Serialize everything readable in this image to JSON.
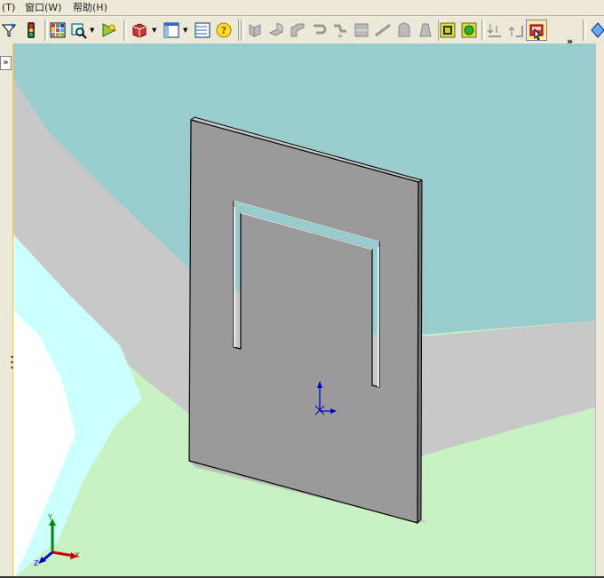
{
  "menu": {
    "items": [
      {
        "label": "(T)"
      },
      {
        "label": "窗口(W)"
      },
      {
        "label": "帮助(H)"
      }
    ]
  },
  "toolbar": {
    "overflow": "»",
    "active_tool": "section-view"
  },
  "panel": {
    "expand_glyph": "»"
  },
  "triad": {
    "x": "X",
    "y": "Y",
    "z": "Z"
  },
  "colors": {
    "sky": "#99cccc",
    "ground": "#c8f2c4",
    "band": "#c8c8c8",
    "river": "#ccffff",
    "part": "#9a9a9a",
    "edge": "#000000",
    "axis_x": "#cc0000",
    "axis_y": "#008800",
    "axis_z": "#0000cc"
  }
}
